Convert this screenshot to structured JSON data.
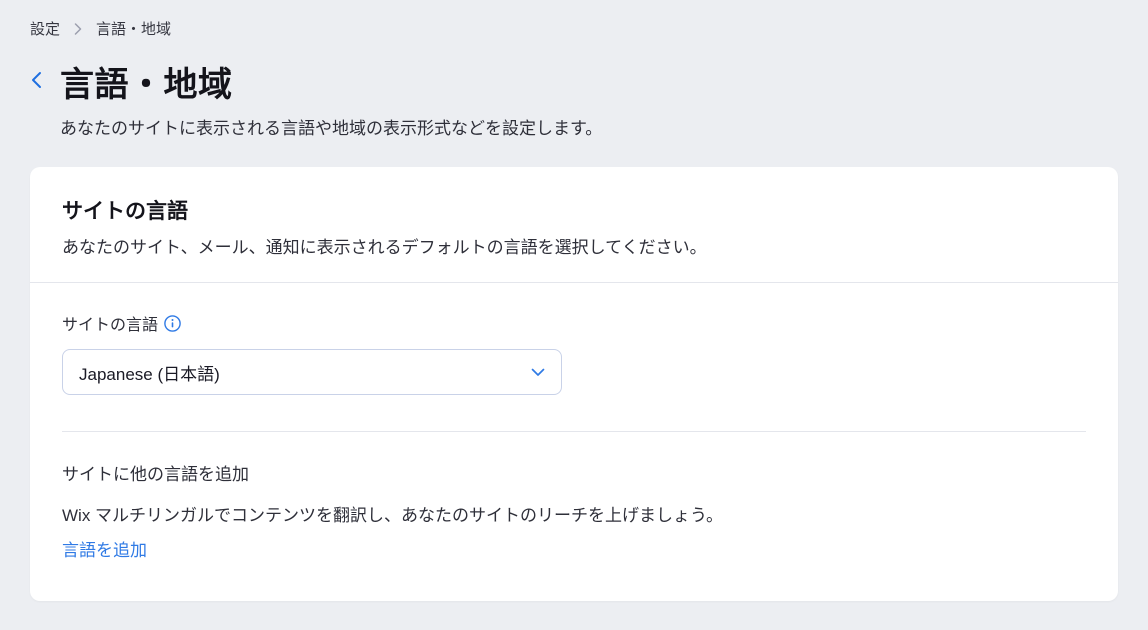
{
  "breadcrumb": {
    "root": "設定",
    "current": "言語・地域"
  },
  "header": {
    "title": "言語・地域",
    "description": "あなたのサイトに表示される言語や地域の表示形式などを設定します。"
  },
  "card": {
    "title": "サイトの言語",
    "subtitle": "あなたのサイト、メール、通知に表示されるデフォルトの言語を選択してください。",
    "field_label": "サイトの言語",
    "selected_value": "Japanese (日本語)",
    "multilingual": {
      "title": "サイトに他の言語を追加",
      "description": "Wix マルチリンガルでコンテンツを翻訳し、あなたのサイトのリーチを上げましょう。",
      "link_label": "言語を追加"
    }
  }
}
